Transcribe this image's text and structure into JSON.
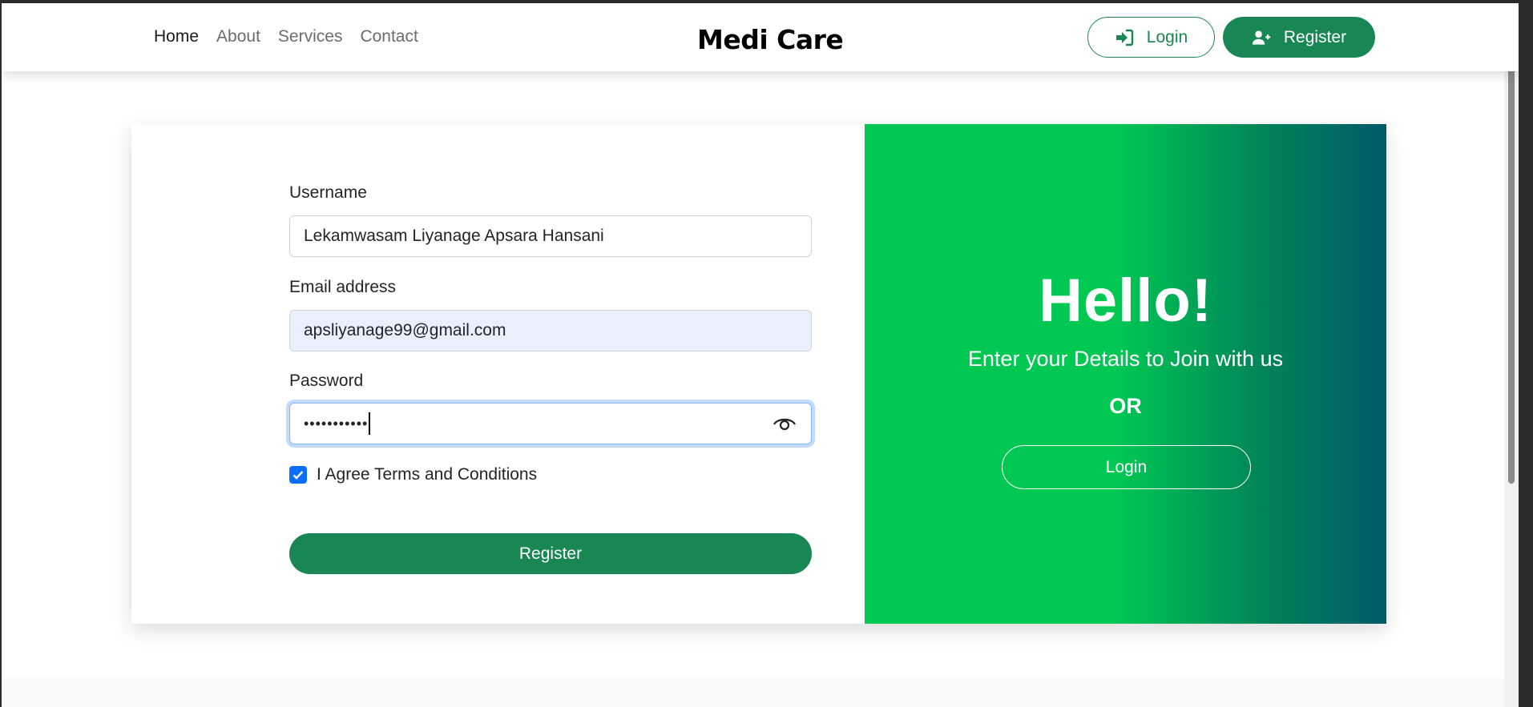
{
  "nav": {
    "links": [
      "Home",
      "About",
      "Services",
      "Contact"
    ],
    "brand": "Medi Care",
    "login_label": "Login",
    "register_label": "Register"
  },
  "form": {
    "username_label": "Username",
    "username_value": "Lekamwasam Liyanage Apsara Hansani",
    "email_label": "Email address",
    "email_value": "apsliyanage99@gmail.com",
    "password_label": "Password",
    "password_value": "•••••••••••",
    "terms_label": "I Agree Terms and Conditions",
    "terms_checked": true,
    "submit_label": "Register"
  },
  "hero": {
    "title": "Hello!",
    "subtitle": "Enter your Details to Join with us",
    "or_text": "OR",
    "login_label": "Login"
  },
  "colors": {
    "primary_green": "#198754",
    "accent_green": "#00c853",
    "teal": "#005a6a",
    "checkbox_blue": "#0d6efd"
  }
}
